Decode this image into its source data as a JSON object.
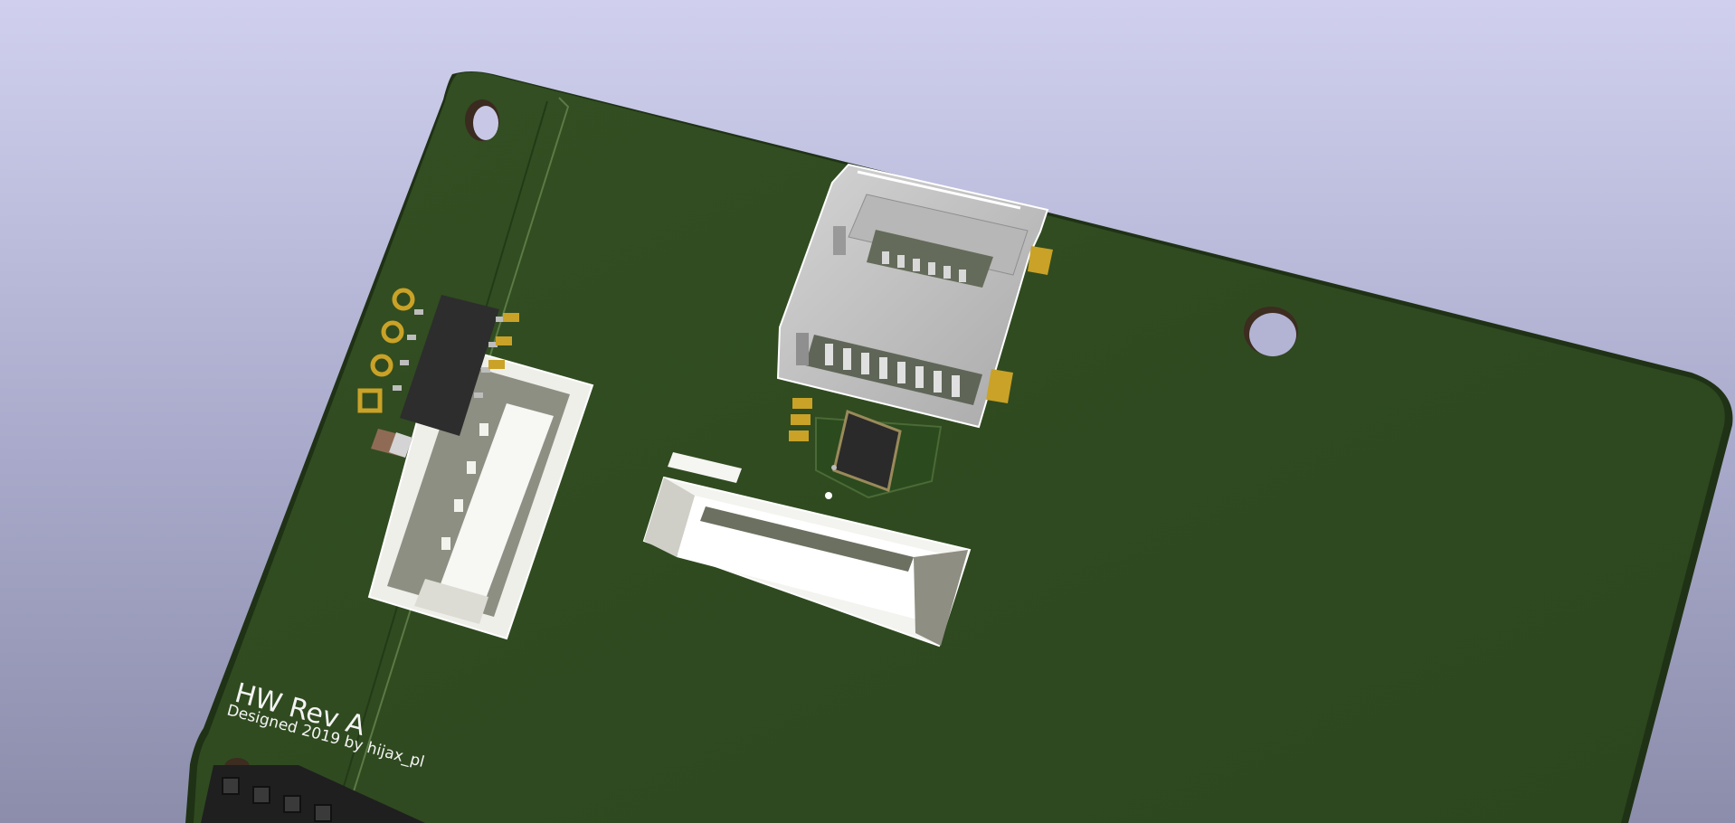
{
  "viewer": {
    "scene": "3d-pcb-render"
  },
  "board": {
    "silkscreen": {
      "title": "HW  Rev A",
      "credit": "Designed 2019 by hijax_pl"
    },
    "colors": {
      "background_top": "#d0d0ee",
      "background_bottom": "#8c8dab",
      "pcb": "#2f4a20",
      "pcb_edge": "#1e3014",
      "silkscreen": "#f4f4f4",
      "connector_body": "#f2f2ee",
      "sd_slot_metal": "#c0c0c0",
      "ic_body": "#2a2a2a",
      "gold_pad": "#c9a227"
    },
    "components": [
      "mounting-hole",
      "sd-card-slot",
      "qfn-ic",
      "ffc-connector",
      "jst-connector",
      "soic-ic",
      "pin-header",
      "smd-capacitor"
    ]
  }
}
